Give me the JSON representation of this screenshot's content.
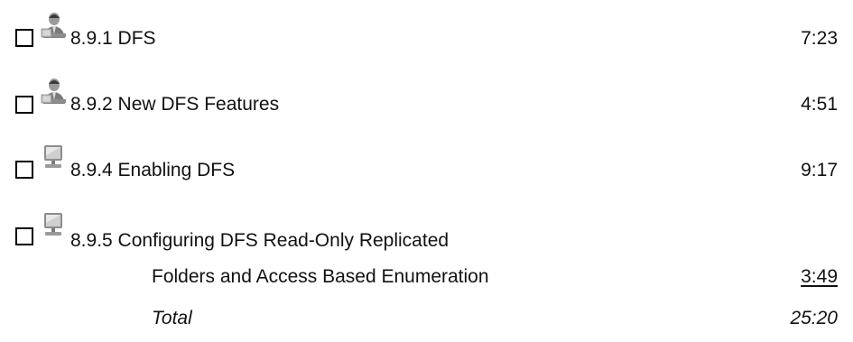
{
  "lessons": [
    {
      "icon": "instructor-video-icon",
      "title": "8.9.1 DFS",
      "duration": "7:23"
    },
    {
      "icon": "instructor-video-icon",
      "title": "8.9.2 New DFS Features",
      "duration": "4:51"
    },
    {
      "icon": "computer-demo-icon",
      "title": "8.9.4 Enabling DFS",
      "duration": "9:17"
    },
    {
      "icon": "computer-demo-icon",
      "title_line1": "8.9.5 Configuring DFS Read-Only Replicated",
      "title_line2": "Folders and Access Based Enumeration",
      "duration": "3:49"
    }
  ],
  "total": {
    "label": "Total",
    "value": "25:20"
  }
}
